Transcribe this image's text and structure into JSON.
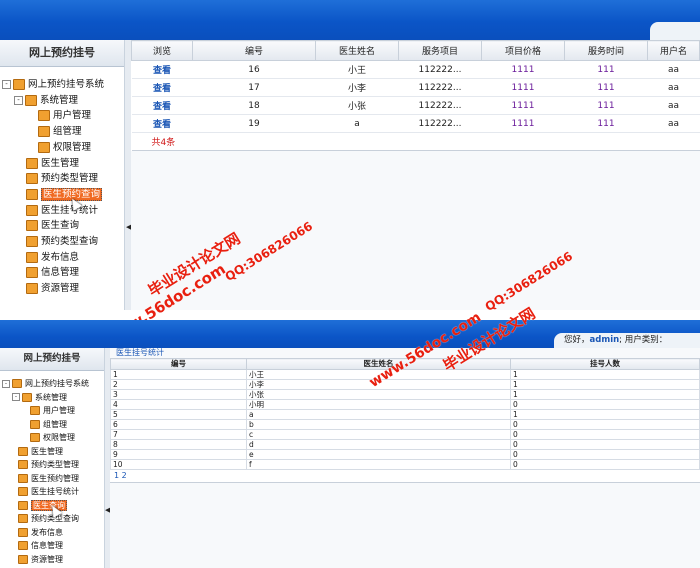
{
  "panel1": {
    "sidebar": {
      "title": "网上预约挂号",
      "tree": [
        {
          "label": "网上预约挂号系统",
          "expander": "-"
        },
        {
          "label": "系统管理",
          "expander": "-"
        },
        {
          "label": "用户管理"
        },
        {
          "label": "组管理"
        },
        {
          "label": "权限管理"
        },
        {
          "label": "医生管理"
        },
        {
          "label": "预约类型管理"
        },
        {
          "label": "医生预约查询",
          "selected": true
        },
        {
          "label": "医生挂号统计"
        },
        {
          "label": "医生查询"
        },
        {
          "label": "预约类型查询"
        },
        {
          "label": "发布信息"
        },
        {
          "label": "信息管理"
        },
        {
          "label": "资源管理"
        }
      ]
    },
    "table": {
      "headers": [
        "浏览",
        "编号",
        "医生姓名",
        "服务项目",
        "项目价格",
        "服务时间",
        "用户名"
      ],
      "rows": [
        [
          "查看",
          "16",
          "小王",
          "112222...",
          "1111",
          "111",
          "aa"
        ],
        [
          "查看",
          "17",
          "小李",
          "112222...",
          "1111",
          "111",
          "aa"
        ],
        [
          "查看",
          "18",
          "小张",
          "112222...",
          "1111",
          "111",
          "aa"
        ],
        [
          "查看",
          "19",
          "a",
          "112222...",
          "1111",
          "111",
          "aa"
        ]
      ],
      "total": "共4条"
    }
  },
  "watermark": {
    "line1": "毕业设计论文网",
    "line2": "www.56doc.com",
    "qq": "QQ:306826066"
  },
  "panel2": {
    "header": {
      "greeting": "您好，",
      "user": "admin",
      "suffix": "; 用户类别："
    },
    "sidebar": {
      "title": "网上预约挂号",
      "tree": [
        {
          "label": "网上预约挂号系统",
          "expander": "-"
        },
        {
          "label": "系统管理",
          "expander": "-"
        },
        {
          "label": "用户管理"
        },
        {
          "label": "组管理"
        },
        {
          "label": "权限管理"
        },
        {
          "label": "医生管理"
        },
        {
          "label": "预约类型管理"
        },
        {
          "label": "医生预约管理"
        },
        {
          "label": "医生挂号统计"
        },
        {
          "label": "医生查询",
          "selected": true
        },
        {
          "label": "预约类型查询"
        },
        {
          "label": "发布信息"
        },
        {
          "label": "信息管理"
        },
        {
          "label": "资源管理"
        }
      ]
    },
    "breadcrumb": "医生挂号统计",
    "table": {
      "headers": [
        "编号",
        "医生姓名",
        "挂号人数"
      ],
      "rows": [
        [
          "1",
          "小王",
          "1"
        ],
        [
          "2",
          "小李",
          "1"
        ],
        [
          "3",
          "小张",
          "1"
        ],
        [
          "4",
          "小明",
          "0"
        ],
        [
          "5",
          "a",
          "1"
        ],
        [
          "6",
          "b",
          "0"
        ],
        [
          "7",
          "c",
          "0"
        ],
        [
          "8",
          "d",
          "0"
        ],
        [
          "9",
          "e",
          "0"
        ],
        [
          "10",
          "f",
          "0"
        ]
      ]
    },
    "pager": "1 2"
  }
}
